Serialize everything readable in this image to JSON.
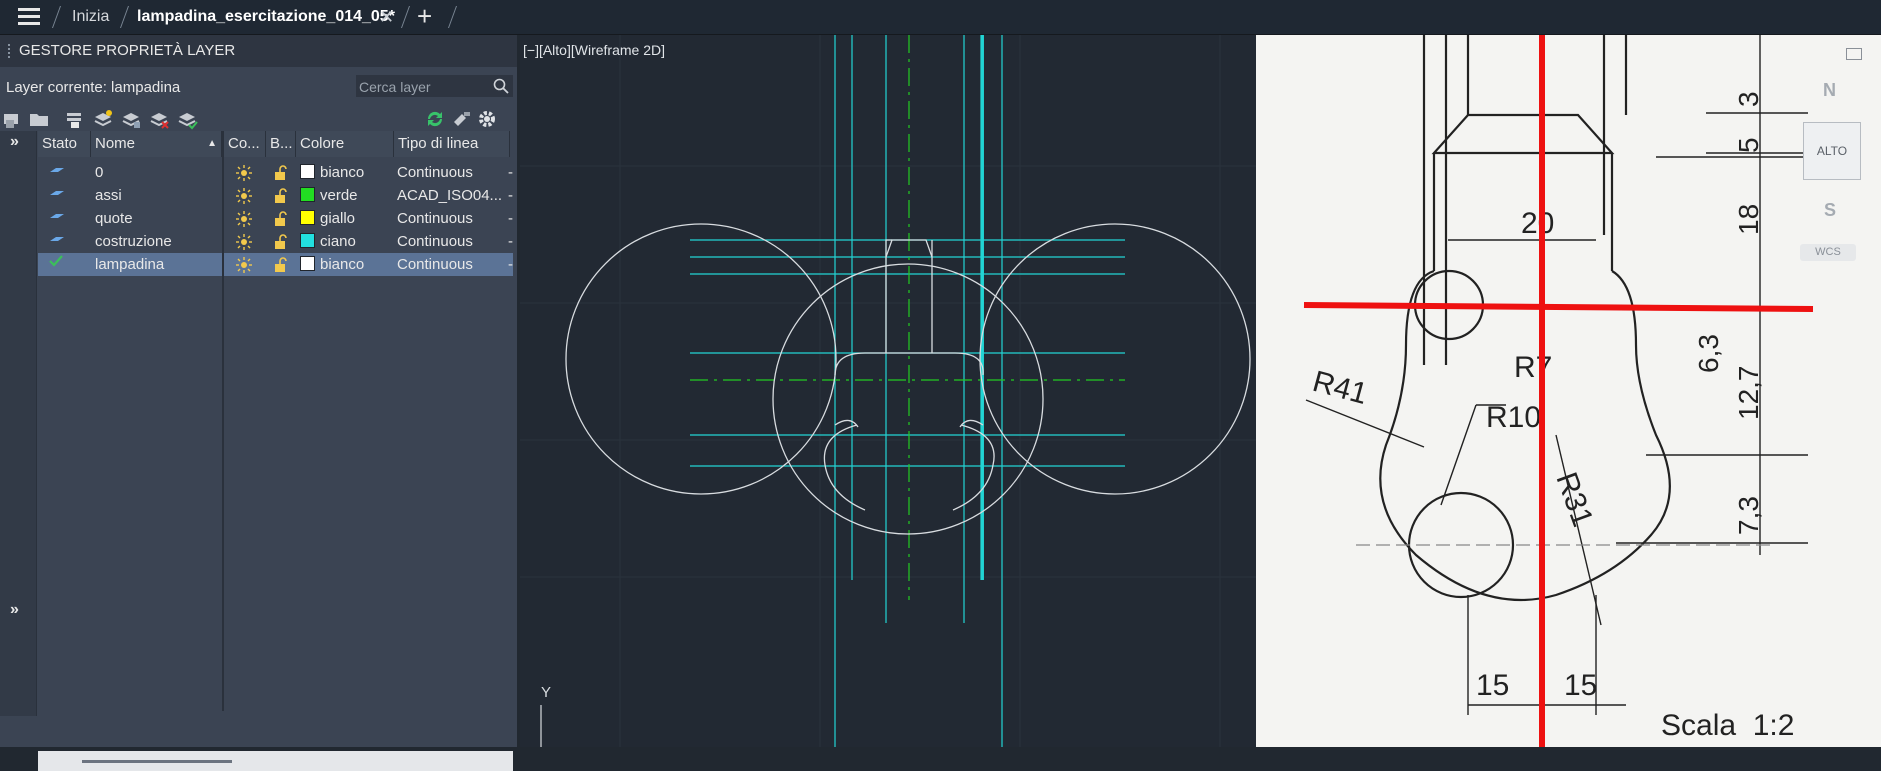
{
  "titlebar": {
    "tabs": [
      {
        "label": "Inizia"
      },
      {
        "label": "lampadina_esercitazione_014_05*"
      }
    ],
    "close_glyph": "✕",
    "add_glyph": "+"
  },
  "layer_panel": {
    "title": "GESTORE PROPRIETÀ LAYER",
    "current_layer": "Layer corrente: lampadina",
    "search_placeholder": "Cerca layer",
    "columns": {
      "stato": "Stato",
      "nome": "Nome",
      "co": "Co...",
      "b": "B...",
      "colore": "Colore",
      "tipo": "Tipo di linea"
    },
    "layers": [
      {
        "name": "0",
        "color_name": "bianco",
        "color_hex": "#ffffff",
        "linetype": "Continuous",
        "current": false
      },
      {
        "name": "assi",
        "color_name": "verde",
        "color_hex": "#22dd22",
        "linetype": "ACAD_ISO04...",
        "current": false
      },
      {
        "name": "quote",
        "color_name": "giallo",
        "color_hex": "#ffff00",
        "linetype": "Continuous",
        "current": false
      },
      {
        "name": "costruzione",
        "color_name": "ciano",
        "color_hex": "#22e0e0",
        "linetype": "Continuous",
        "current": false
      },
      {
        "name": "lampadina",
        "color_name": "bianco",
        "color_hex": "#ffffff",
        "linetype": "Continuous",
        "current": true
      }
    ],
    "trailing_dash": "-"
  },
  "viewport": {
    "label": "[−][Alto][Wireframe 2D]",
    "ucs_axis": "Y"
  },
  "reference": {
    "dims": {
      "d3": "3",
      "d5": "5",
      "d18": "18",
      "d20": "20",
      "d63": "6,3",
      "d127": "12,7",
      "d73": "7,3",
      "d15a": "15",
      "d15b": "15"
    },
    "radii": {
      "r41": "R41",
      "r10": "R10",
      "r7": "R7",
      "r31": "R31"
    },
    "scale": "Scala  1:2"
  },
  "navcube": {
    "n": "N",
    "s": "S",
    "face": "ALTO",
    "wcs": "WCS"
  }
}
